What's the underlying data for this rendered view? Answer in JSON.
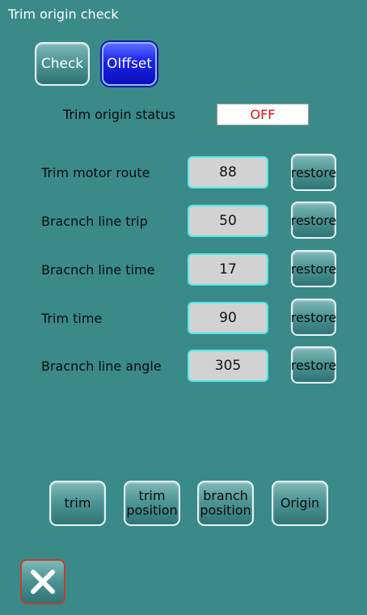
{
  "window": {
    "title": "Trim origin check"
  },
  "tabs": {
    "check_label": "Check",
    "offset_label": "OIffset",
    "active": "offset"
  },
  "status": {
    "label": "Trim origin status",
    "value": "OFF"
  },
  "rows": [
    {
      "label": "Trim motor route",
      "value": "88",
      "restore_label": "restore"
    },
    {
      "label": "Bracnch line trip",
      "value": "50",
      "restore_label": "restore"
    },
    {
      "label": "Bracnch line time",
      "value": "17",
      "restore_label": "restore"
    },
    {
      "label": "Trim time",
      "value": "90",
      "restore_label": "restore"
    },
    {
      "label": "Bracnch line angle",
      "value": "305",
      "restore_label": "restore"
    }
  ],
  "bottom_buttons": {
    "trim": "trim",
    "trim_position_line1": "trim",
    "trim_position_line2": "position",
    "branch_position_line1": "branch",
    "branch_position_line2": "position",
    "origin": "Origin"
  },
  "close_icon": "close-x-icon",
  "colors": {
    "background": "#3a8a8a",
    "active_tab": "#1a22ee",
    "status_off": "#e01010",
    "value_border": "#4ee8e8",
    "close_border": "#c04030"
  }
}
